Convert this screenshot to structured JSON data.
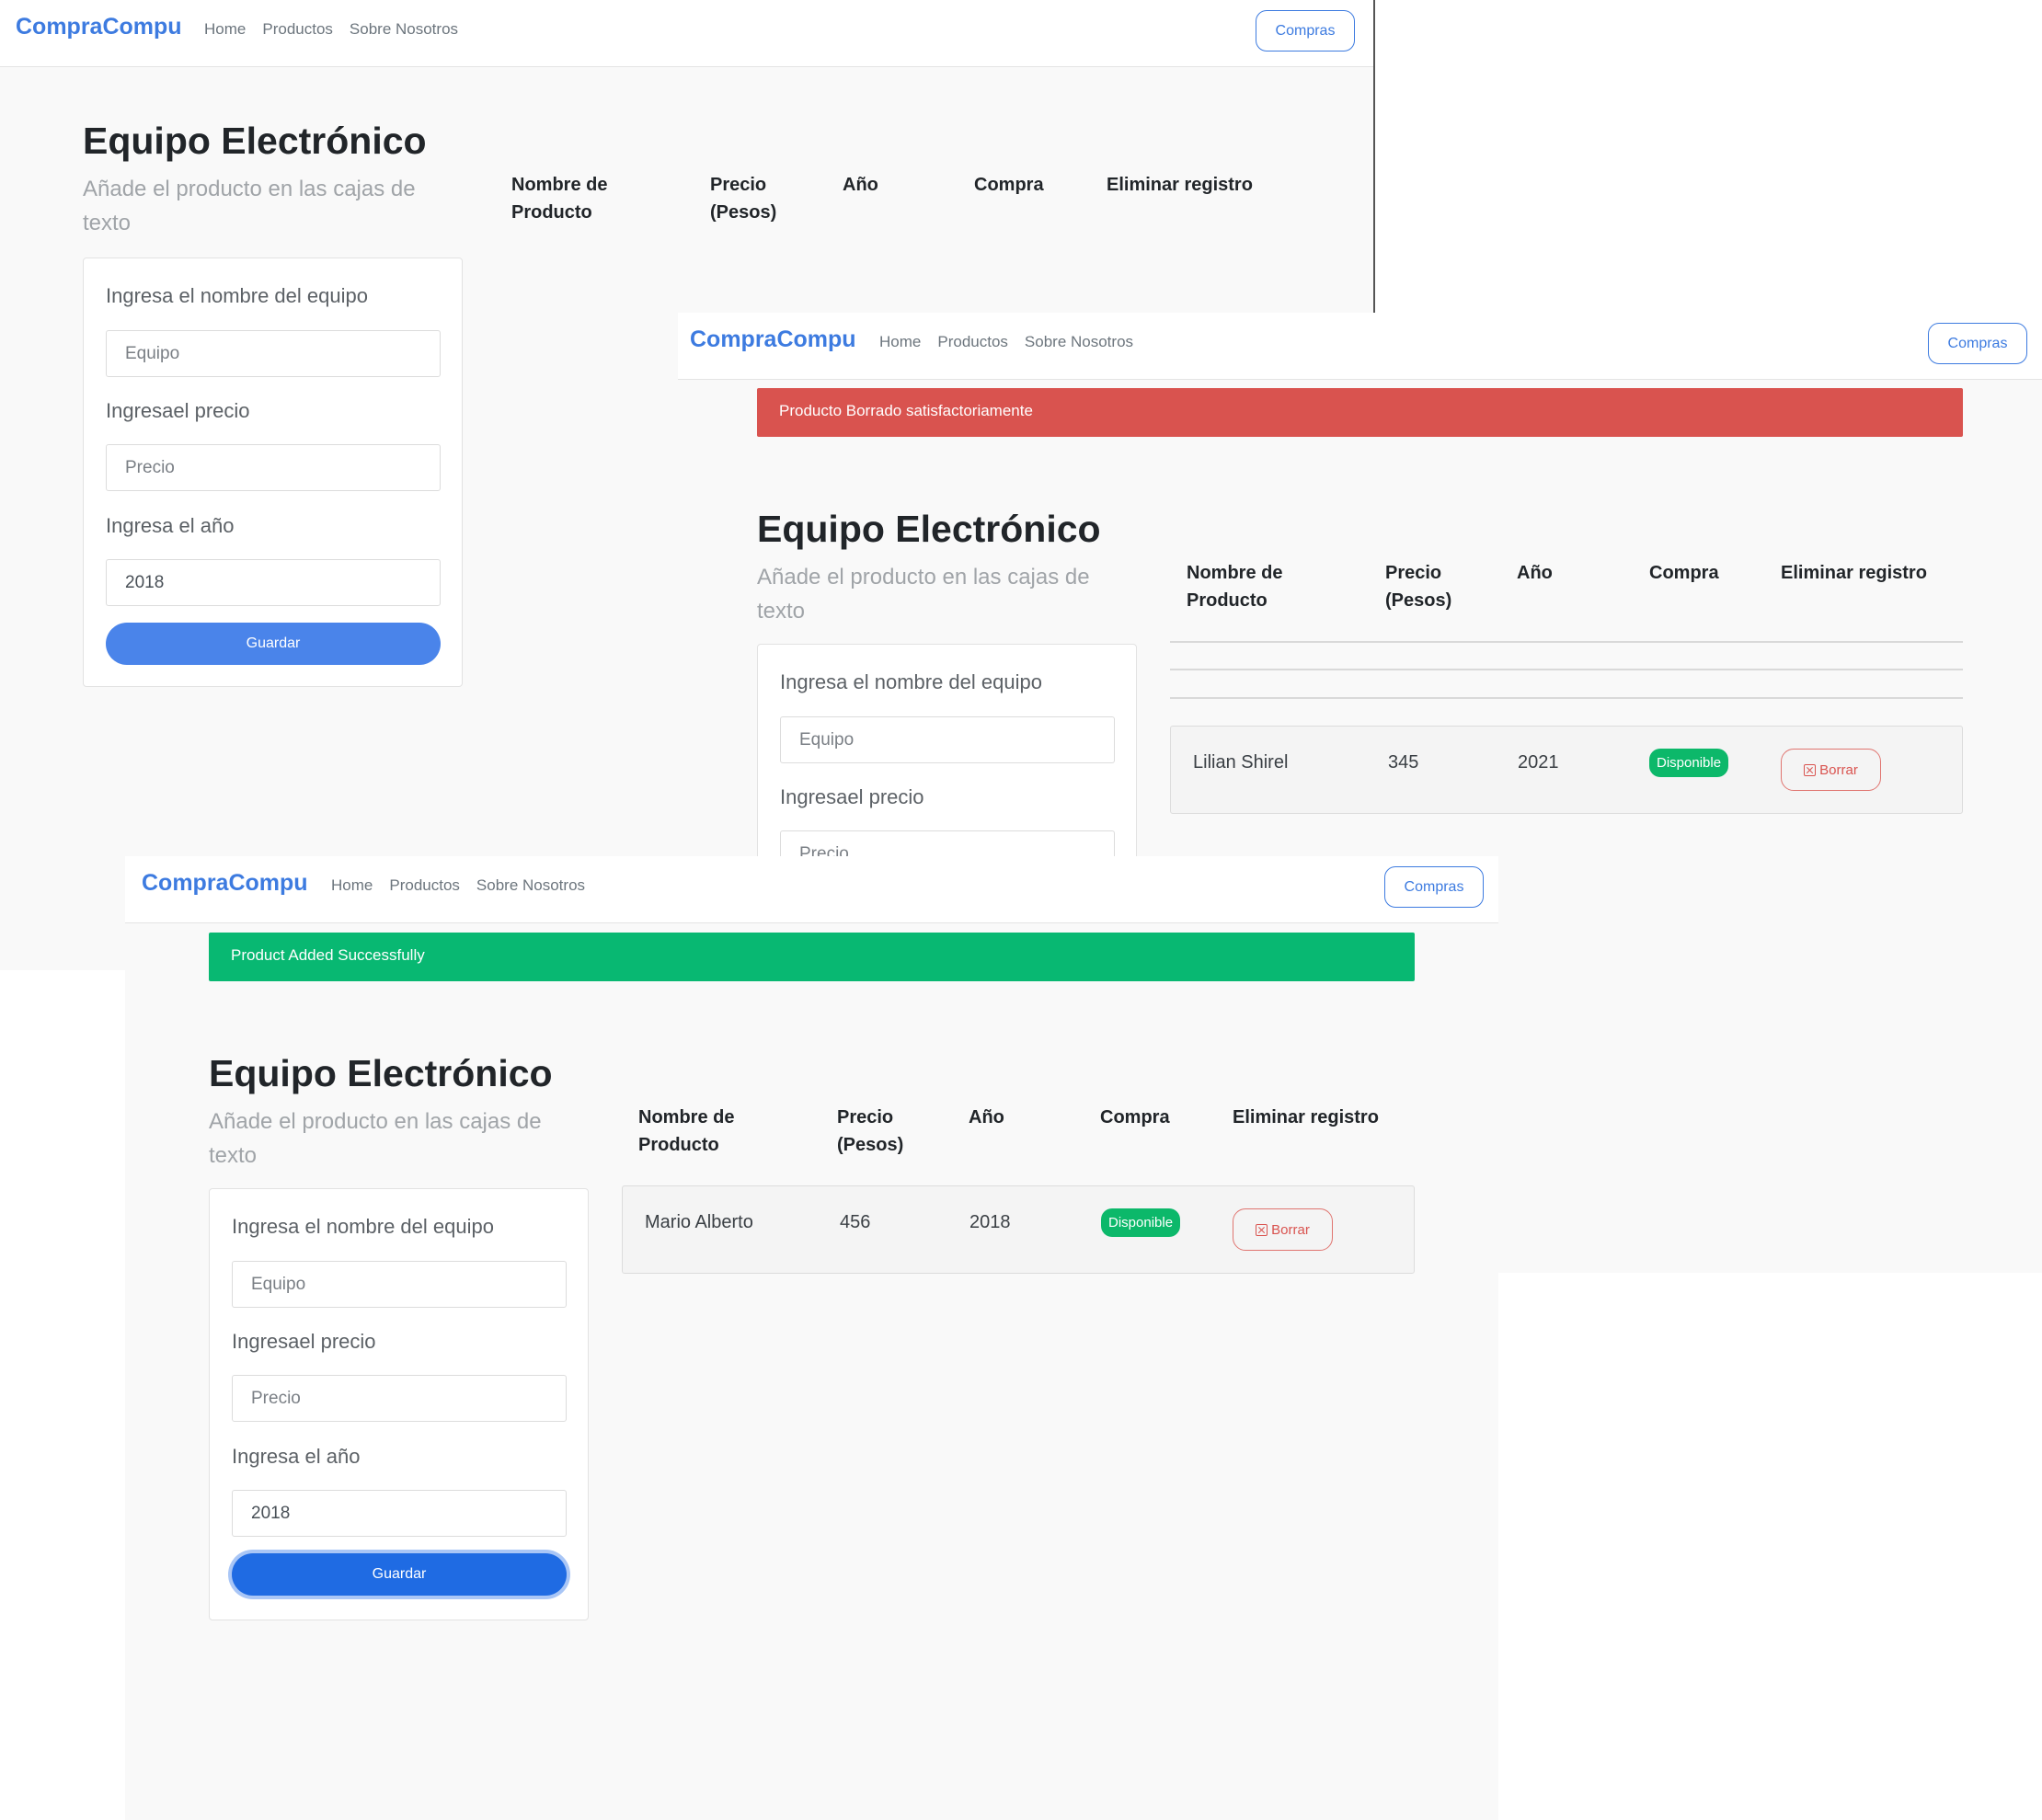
{
  "brand": "CompraCompu",
  "nav": {
    "links": [
      "Home",
      "Productos",
      "Sobre Nosotros"
    ],
    "cart_button": "Compras"
  },
  "page": {
    "title": "Equipo Electrónico",
    "subtitle": "Añade el producto en las cajas de texto"
  },
  "form": {
    "name_label": "Ingresa el nombre del equipo",
    "name_placeholder": "Equipo",
    "price_label": "Ingresael precio",
    "price_placeholder": "Precio",
    "year_label": "Ingresa el año",
    "year_value": "2018",
    "submit_label": "Guardar"
  },
  "table": {
    "headers": [
      "Nombre de Producto",
      "Precio (Pesos)",
      "Año",
      "Compra",
      "Eliminar registro"
    ]
  },
  "alerts": {
    "deleted": "Producto Borrado satisfactoriamente",
    "added": "Product Added Successfully"
  },
  "screens": {
    "deleted": {
      "row": {
        "name": "Lilian Shirel",
        "price": "345",
        "year": "2021",
        "status": "Disponible",
        "action": "Borrar"
      }
    },
    "added": {
      "row": {
        "name": "Mario Alberto",
        "price": "456",
        "year": "2018",
        "status": "Disponible",
        "action": "Borrar"
      }
    }
  },
  "colors": {
    "primary": "#3d7be0",
    "danger": "#d9534f",
    "success": "#08b872"
  },
  "icons": {
    "delete": "x-square-icon"
  }
}
